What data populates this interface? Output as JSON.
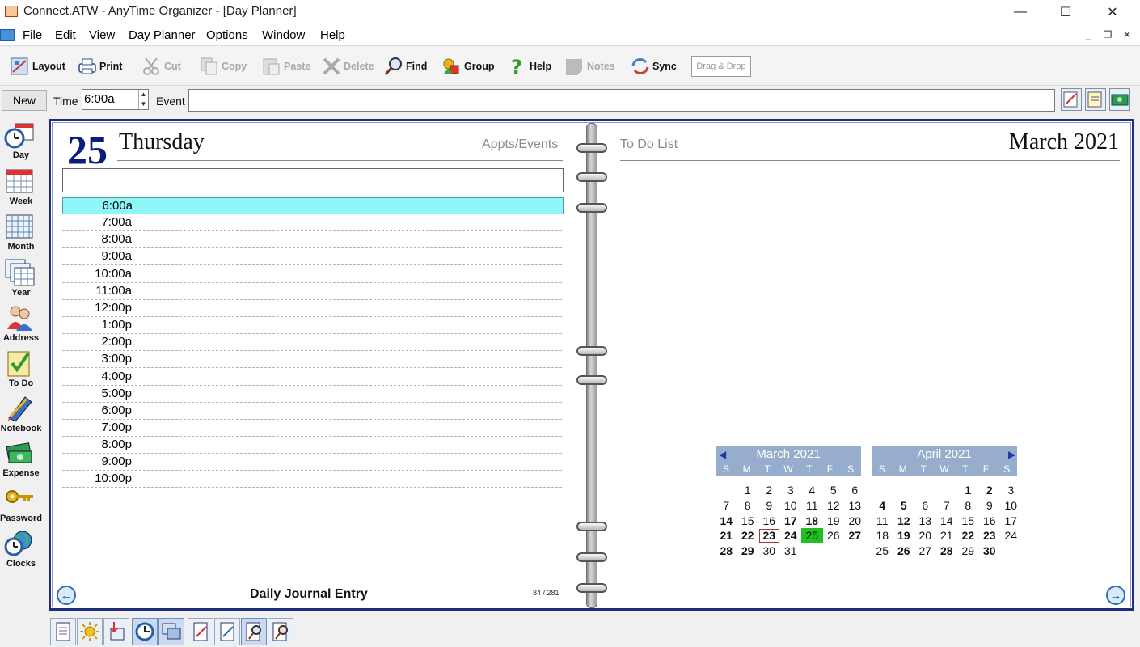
{
  "window": {
    "title": "Connect.ATW - AnyTime Organizer - [Day Planner]"
  },
  "menu": [
    "File",
    "Edit",
    "View",
    "Day Planner",
    "Options",
    "Window",
    "Help"
  ],
  "toolbar": [
    {
      "label": "Layout",
      "enabled": true
    },
    {
      "label": "Print",
      "enabled": true
    },
    {
      "label": "Cut",
      "enabled": false
    },
    {
      "label": "Copy",
      "enabled": false
    },
    {
      "label": "Paste",
      "enabled": false
    },
    {
      "label": "Delete",
      "enabled": false
    },
    {
      "label": "Find",
      "enabled": true
    },
    {
      "label": "Group",
      "enabled": true
    },
    {
      "label": "Help",
      "enabled": true
    },
    {
      "label": "Notes",
      "enabled": false
    },
    {
      "label": "Sync",
      "enabled": true
    }
  ],
  "drag_drop_label": "Drag & Drop",
  "event_row": {
    "new_label": "New",
    "time_label": "Time",
    "time_value": "6:00a",
    "event_label": "Event",
    "event_value": ""
  },
  "nav": [
    "Day",
    "Week",
    "Month",
    "Year",
    "Address",
    "To Do",
    "Notebook",
    "Expense",
    "Password",
    "Clocks"
  ],
  "planner": {
    "day_number": "25",
    "day_name": "Thursday",
    "appts_label": "Appts/Events",
    "todo_label": "To Do List",
    "month_title": "March 2021",
    "selected_slot": "6:00a",
    "slots": [
      "6:00a",
      "7:00a",
      "8:00a",
      "9:00a",
      "10:00a",
      "11:00a",
      "12:00p",
      "1:00p",
      "2:00p",
      "3:00p",
      "4:00p",
      "5:00p",
      "6:00p",
      "7:00p",
      "8:00p",
      "9:00p",
      "10:00p"
    ],
    "journal_label": "Daily Journal Entry",
    "page_count": "84 / 281"
  },
  "mini_calendars": {
    "weekday_headers": [
      "S",
      "M",
      "T",
      "W",
      "T",
      "F",
      "S"
    ],
    "months": [
      {
        "title": "March 2021",
        "today": 23,
        "current": 25,
        "weeks": [
          [
            null,
            "1",
            "2",
            "3",
            "4",
            "5",
            "6"
          ],
          [
            "7",
            "8",
            "9",
            "10",
            "11",
            "12",
            "13"
          ],
          [
            "14",
            "15",
            "16",
            "17",
            "18",
            "19",
            "20"
          ],
          [
            "21",
            "22",
            "23",
            "24",
            "25",
            "26",
            "27"
          ],
          [
            "28",
            "29",
            "30",
            "31",
            null,
            null,
            null
          ]
        ],
        "bold_days": [
          "14",
          "17",
          "18",
          "21",
          "22",
          "23",
          "24",
          "27",
          "28",
          "29"
        ]
      },
      {
        "title": "April 2021",
        "weeks": [
          [
            null,
            null,
            null,
            null,
            "1",
            "2",
            "3"
          ],
          [
            "4",
            "5",
            "6",
            "7",
            "8",
            "9",
            "10"
          ],
          [
            "11",
            "12",
            "13",
            "14",
            "15",
            "16",
            "17"
          ],
          [
            "18",
            "19",
            "20",
            "21",
            "22",
            "23",
            "24"
          ],
          [
            "25",
            "26",
            "27",
            "28",
            "29",
            "30",
            null
          ]
        ],
        "bold_days": [
          "1",
          "2",
          "4",
          "5",
          "12",
          "19",
          "22",
          "23",
          "26",
          "28",
          "30"
        ]
      }
    ]
  }
}
